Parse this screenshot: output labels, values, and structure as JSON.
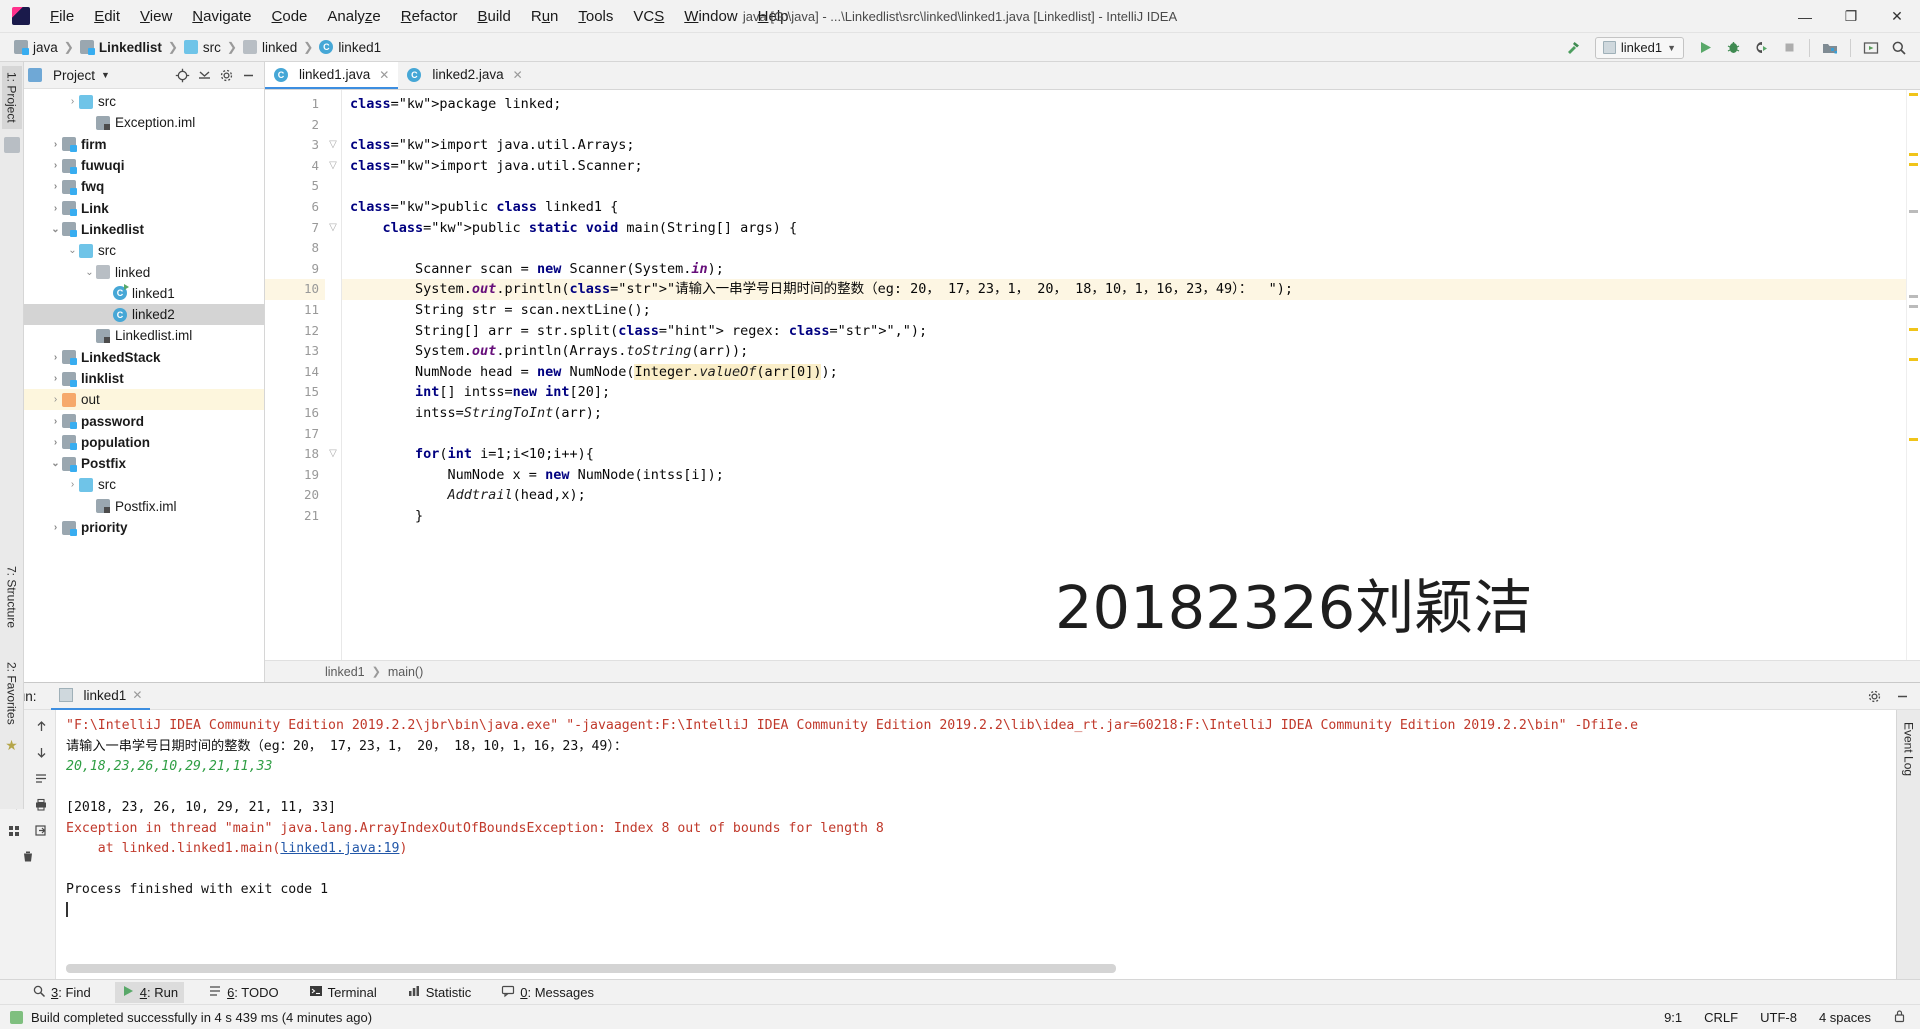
{
  "window": {
    "title": "java [G:\\java] - ...\\Linkedlist\\src\\linked\\linked1.java [Linkedlist] - IntelliJ IDEA",
    "minimize": "—",
    "maximize": "❐",
    "close": "✕"
  },
  "menu": [
    {
      "label": "File",
      "mnemonic": "F"
    },
    {
      "label": "Edit",
      "mnemonic": "E"
    },
    {
      "label": "View",
      "mnemonic": "V"
    },
    {
      "label": "Navigate",
      "mnemonic": "N"
    },
    {
      "label": "Code",
      "mnemonic": "C"
    },
    {
      "label": "Analyze",
      "mnemonic": "z"
    },
    {
      "label": "Refactor",
      "mnemonic": "R"
    },
    {
      "label": "Build",
      "mnemonic": "B"
    },
    {
      "label": "Run",
      "mnemonic": "u"
    },
    {
      "label": "Tools",
      "mnemonic": "T"
    },
    {
      "label": "VCS",
      "mnemonic": "S"
    },
    {
      "label": "Window",
      "mnemonic": "W"
    },
    {
      "label": "Help",
      "mnemonic": "H"
    }
  ],
  "breadcrumbs": [
    {
      "label": "java",
      "icon": "module-icon",
      "bold": false
    },
    {
      "label": "Linkedlist",
      "icon": "module-icon",
      "bold": true
    },
    {
      "label": "src",
      "icon": "source-folder-icon",
      "bold": false
    },
    {
      "label": "linked",
      "icon": "package-folder-icon",
      "bold": false
    },
    {
      "label": "linked1",
      "icon": "java-class-icon",
      "bold": false
    }
  ],
  "toolbar": {
    "build_label": "build-hammer",
    "run_config": "linked1",
    "run": "▶",
    "debug": "debug-beetle",
    "run_coverage": "run-with-coverage",
    "stop": "stop-square",
    "buttons": [
      "build-icon",
      "run-config-selector",
      "run-icon",
      "debug-icon",
      "coverage-icon",
      "stop-icon",
      "update-project-icon",
      "presentation-icon",
      "search-everywhere-icon"
    ]
  },
  "project_pane": {
    "title": "Project",
    "rail_tab": "1: Project",
    "actions": [
      "locate-icon",
      "collapse-all-icon",
      "settings-gear-icon",
      "hide-icon"
    ],
    "tree": [
      {
        "label": "src",
        "depth": 2,
        "arrow": "collapsed",
        "icon": "source-folder-icon",
        "bold": false,
        "state": "normal"
      },
      {
        "label": "Exception.iml",
        "depth": 3,
        "arrow": "none",
        "icon": "iml-file-icon",
        "bold": false,
        "state": "normal"
      },
      {
        "label": "firm",
        "depth": 1,
        "arrow": "collapsed",
        "icon": "module-icon",
        "bold": true,
        "state": "normal"
      },
      {
        "label": "fuwuqi",
        "depth": 1,
        "arrow": "collapsed",
        "icon": "module-icon",
        "bold": true,
        "state": "normal"
      },
      {
        "label": "fwq",
        "depth": 1,
        "arrow": "collapsed",
        "icon": "module-icon",
        "bold": true,
        "state": "normal"
      },
      {
        "label": "Link",
        "depth": 1,
        "arrow": "collapsed",
        "icon": "module-icon",
        "bold": true,
        "state": "normal"
      },
      {
        "label": "Linkedlist",
        "depth": 1,
        "arrow": "expanded",
        "icon": "module-icon",
        "bold": true,
        "state": "normal"
      },
      {
        "label": "src",
        "depth": 2,
        "arrow": "expanded",
        "icon": "source-folder-icon",
        "bold": false,
        "state": "normal"
      },
      {
        "label": "linked",
        "depth": 3,
        "arrow": "expanded",
        "icon": "package-folder-icon",
        "bold": false,
        "state": "normal"
      },
      {
        "label": "linked1",
        "depth": 4,
        "arrow": "none",
        "icon": "java-class-runnable-icon",
        "bold": false,
        "state": "normal"
      },
      {
        "label": "linked2",
        "depth": 4,
        "arrow": "none",
        "icon": "java-class-icon",
        "bold": false,
        "state": "selected"
      },
      {
        "label": "Linkedlist.iml",
        "depth": 3,
        "arrow": "none",
        "icon": "iml-file-icon",
        "bold": false,
        "state": "normal"
      },
      {
        "label": "LinkedStack",
        "depth": 1,
        "arrow": "collapsed",
        "icon": "module-icon",
        "bold": true,
        "state": "normal"
      },
      {
        "label": "linklist",
        "depth": 1,
        "arrow": "collapsed",
        "icon": "module-icon",
        "bold": true,
        "state": "normal"
      },
      {
        "label": "out",
        "depth": 1,
        "arrow": "collapsed",
        "icon": "excluded-folder-icon",
        "bold": false,
        "state": "highlighted"
      },
      {
        "label": "password",
        "depth": 1,
        "arrow": "collapsed",
        "icon": "module-icon",
        "bold": true,
        "state": "normal"
      },
      {
        "label": "population",
        "depth": 1,
        "arrow": "collapsed",
        "icon": "module-icon",
        "bold": true,
        "state": "normal"
      },
      {
        "label": "Postfix",
        "depth": 1,
        "arrow": "expanded",
        "icon": "module-icon",
        "bold": true,
        "state": "normal"
      },
      {
        "label": "src",
        "depth": 2,
        "arrow": "collapsed",
        "icon": "source-folder-icon",
        "bold": false,
        "state": "normal"
      },
      {
        "label": "Postfix.iml",
        "depth": 3,
        "arrow": "none",
        "icon": "iml-file-icon",
        "bold": false,
        "state": "normal"
      },
      {
        "label": "priority",
        "depth": 1,
        "arrow": "collapsed",
        "icon": "module-icon",
        "bold": true,
        "state": "normal"
      }
    ]
  },
  "editor": {
    "tabs": [
      {
        "label": "linked1.java",
        "icon": "java-class-icon",
        "active": true
      },
      {
        "label": "linked2.java",
        "icon": "java-class-icon",
        "active": false
      }
    ],
    "breadcrumb": [
      "linked1",
      "main()"
    ],
    "watermark": "20182326刘颖洁",
    "lines": [
      {
        "n": 1,
        "run": false,
        "fold": "",
        "hl": false
      },
      {
        "n": 2,
        "run": false,
        "fold": "",
        "hl": false
      },
      {
        "n": 3,
        "run": false,
        "fold": "minus",
        "hl": false
      },
      {
        "n": 4,
        "run": false,
        "fold": "minus",
        "hl": false
      },
      {
        "n": 5,
        "run": false,
        "fold": "",
        "hl": false
      },
      {
        "n": 6,
        "run": true,
        "fold": "",
        "hl": false
      },
      {
        "n": 7,
        "run": true,
        "fold": "minus",
        "hl": false
      },
      {
        "n": 8,
        "run": false,
        "fold": "",
        "hl": false
      },
      {
        "n": 9,
        "run": false,
        "fold": "",
        "hl": false
      },
      {
        "n": 10,
        "run": false,
        "fold": "",
        "hl": true
      },
      {
        "n": 11,
        "run": false,
        "fold": "",
        "hl": false
      },
      {
        "n": 12,
        "run": false,
        "fold": "",
        "hl": false
      },
      {
        "n": 13,
        "run": false,
        "fold": "",
        "hl": false
      },
      {
        "n": 14,
        "run": false,
        "fold": "",
        "hl": false
      },
      {
        "n": 15,
        "run": false,
        "fold": "",
        "hl": false
      },
      {
        "n": 16,
        "run": false,
        "fold": "",
        "hl": false
      },
      {
        "n": 17,
        "run": false,
        "fold": "",
        "hl": false
      },
      {
        "n": 18,
        "run": false,
        "fold": "minus",
        "hl": false
      },
      {
        "n": 19,
        "run": false,
        "fold": "",
        "hl": false
      },
      {
        "n": 20,
        "run": false,
        "fold": "",
        "hl": false
      },
      {
        "n": 21,
        "run": false,
        "fold": "",
        "hl": false
      }
    ],
    "code_text": [
      "package linked;",
      "",
      "import java.util.Arrays;",
      "import java.util.Scanner;",
      "",
      "public class linked1 {",
      "    public static void main(String[] args) {",
      "",
      "        Scanner scan = new Scanner(System.in);",
      "        System.out.println(\"请输入一串学号日期时间的整数（eg: 20， 17，23，1， 20， 18，10，1，16，23，49）：  \");",
      "        String str = scan.nextLine();",
      "        String[] arr = str.split( regex: \",\");",
      "        System.out.println(Arrays.toString(arr));",
      "        NumNode head = new NumNode(Integer.valueOf(arr[0]));",
      "        int[] intss=new int[20];",
      "        intss=StringToInt(arr);",
      "",
      "        for(int i=1;i<10;i++){",
      "            NumNode x = new NumNode(intss[i]);",
      "            Addtrail(head,x);",
      "        }"
    ]
  },
  "run_window": {
    "label": "Run:",
    "tab": "linked1",
    "tab_icon": "run-config-icon",
    "rail_buttons": [
      "rerun-icon",
      "up-arrow-icon",
      "stop-icon",
      "down-arrow-icon",
      "camera-icon",
      "soft-wrap-icon",
      "print-icon",
      "scroll-to-end-icon",
      "trash-icon"
    ],
    "settings_icon": "gear-icon",
    "hide_icon": "hide-icon",
    "console": [
      {
        "text": "\"F:\\IntelliJ IDEA Community Edition 2019.2.2\\jbr\\bin\\java.exe\" \"-javaagent:F:\\IntelliJ IDEA Community Edition 2019.2.2\\lib\\idea_rt.jar=60218:F:\\IntelliJ IDEA Community Edition 2019.2.2\\bin\" -DfiIe.e",
        "style": "cmd"
      },
      {
        "text": "请输入一串学号日期时间的整数（eg：20， 17，23，1， 20， 18，10，1，16，23，49）：",
        "style": "out"
      },
      {
        "text": "20,18,23,26,10,29,21,11,33",
        "style": "in"
      },
      {
        "text": "",
        "style": "out"
      },
      {
        "text": "[2018, 23, 26, 10, 29, 21, 11, 33]",
        "style": "out"
      },
      {
        "text": "Exception in thread \"main\" java.lang.ArrayIndexOutOfBoundsException: Index 8 out of bounds for length 8",
        "style": "err"
      },
      {
        "text": "    at linked.linked1.main(",
        "link": "linked1.java:19",
        "suffix": ")",
        "style": "err-link"
      },
      {
        "text": "",
        "style": "out"
      },
      {
        "text": "Process finished with exit code 1",
        "style": "out"
      }
    ]
  },
  "left_rail": {
    "tabs": [
      "1: Project"
    ],
    "structure": "7: Structure",
    "favorites": "2: Favorites"
  },
  "right_rail": {
    "tabs": [
      "Event Log"
    ]
  },
  "bottom_toolbar": [
    {
      "label": "3: Find",
      "num": "3",
      "icon": "find-icon",
      "active": false
    },
    {
      "label": "4: Run",
      "num": "4",
      "icon": "run-icon",
      "active": true
    },
    {
      "label": "6: TODO",
      "num": "6",
      "icon": "todo-icon",
      "active": false
    },
    {
      "label": "Terminal",
      "num": "",
      "icon": "terminal-icon",
      "active": false
    },
    {
      "label": "Statistic",
      "num": "",
      "icon": "statistic-icon",
      "active": false
    },
    {
      "label": "0: Messages",
      "num": "0",
      "icon": "messages-icon",
      "active": false
    }
  ],
  "status_bar": {
    "message": "Build completed successfully in 4 s 439 ms (4 minutes ago)",
    "caret": "9:1",
    "line_sep": "CRLF",
    "encoding": "UTF-8",
    "indent": "4 spaces"
  }
}
